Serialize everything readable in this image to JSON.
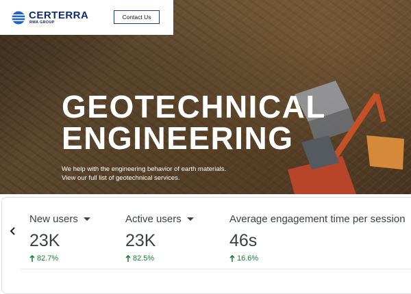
{
  "header": {
    "brand_name": "CERTERRA",
    "brand_sub": "RMA GROUP",
    "contact_label": "Contact Us"
  },
  "hero": {
    "title_line1": "GEOTECHNICAL",
    "title_line2": "ENGINEERING",
    "desc_line1": "We help with the engineering behavior of earth materials.",
    "desc_line2": "View our full list of geotechnical services."
  },
  "metrics": [
    {
      "label": "New users",
      "value": "23K",
      "change": "82.7%"
    },
    {
      "label": "Active users",
      "value": "23K",
      "change": "82.5%"
    },
    {
      "label": "Average engagement time per session",
      "value": "46s",
      "change": "16.6%"
    }
  ],
  "colors": {
    "brand": "#102a71",
    "positive": "#188038",
    "text": "#3c4043"
  }
}
